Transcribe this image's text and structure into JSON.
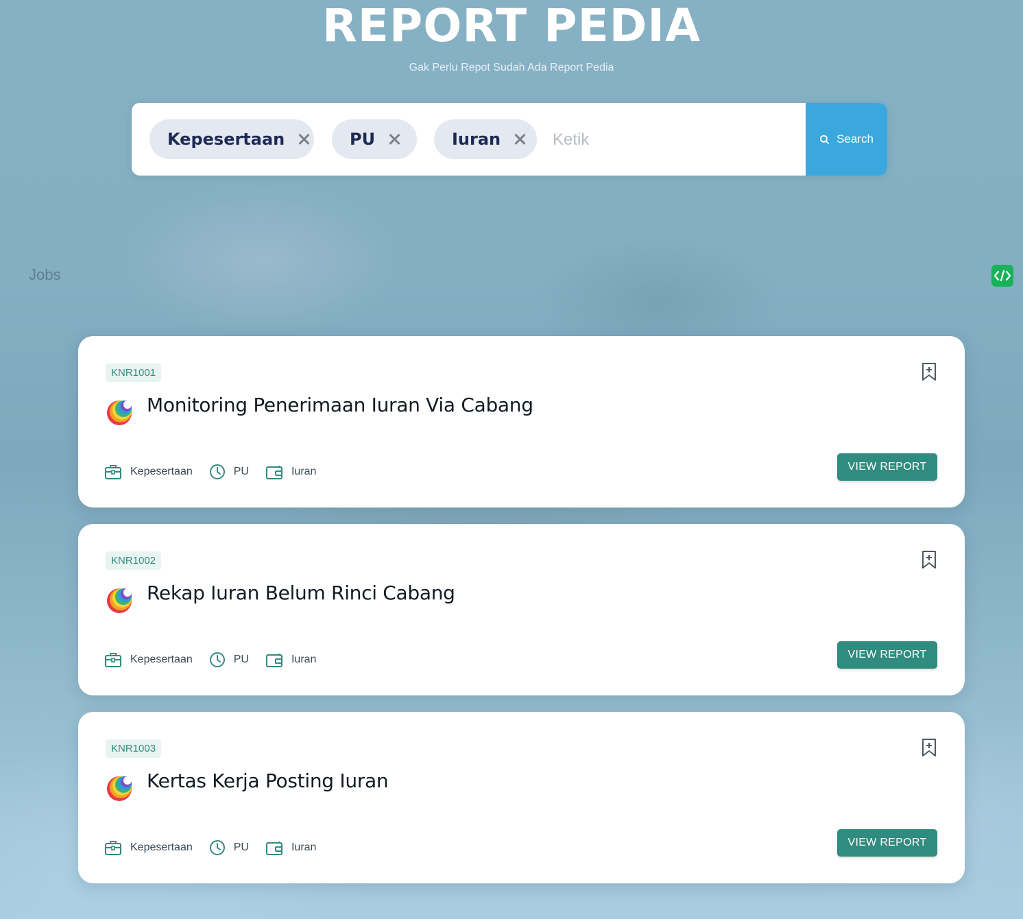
{
  "header": {
    "title": "REPORT PEDIA",
    "subtitle": "Gak Perlu Repot Sudah Ada Report Pedia"
  },
  "search": {
    "chips": [
      {
        "label": "Kepesertaan",
        "icon": "close-icon"
      },
      {
        "label": "PU",
        "icon": "close-icon"
      },
      {
        "label": "Iuran",
        "icon": "close-icon"
      }
    ],
    "placeholder": "Ketik",
    "value": "",
    "button_label": "Search",
    "button_icon": "search-icon"
  },
  "section": {
    "label": "Jobs"
  },
  "code_badge": {
    "icon": "code-icon"
  },
  "jobs": [
    {
      "code": "KNR1001",
      "title": "Monitoring Penerimaan Iuran Via Cabang",
      "meta": [
        "Kepesertaan",
        "PU",
        "Iuran"
      ],
      "button_label": "VIEW REPORT"
    },
    {
      "code": "KNR1002",
      "title": "Rekap Iuran Belum Rinci Cabang",
      "meta": [
        "Kepesertaan",
        "PU",
        "Iuran"
      ],
      "button_label": "VIEW REPORT"
    },
    {
      "code": "KNR1003",
      "title": "Kertas Kerja Posting Iuran",
      "meta": [
        "Kepesertaan",
        "PU",
        "Iuran"
      ],
      "button_label": "VIEW REPORT"
    }
  ],
  "colors": {
    "accent": "#2f8c7e",
    "search_button": "#3aa8dc",
    "chip_background": "#e4e8f0",
    "chip_text": "#1e2a55",
    "code_badge": "#19b25b"
  }
}
